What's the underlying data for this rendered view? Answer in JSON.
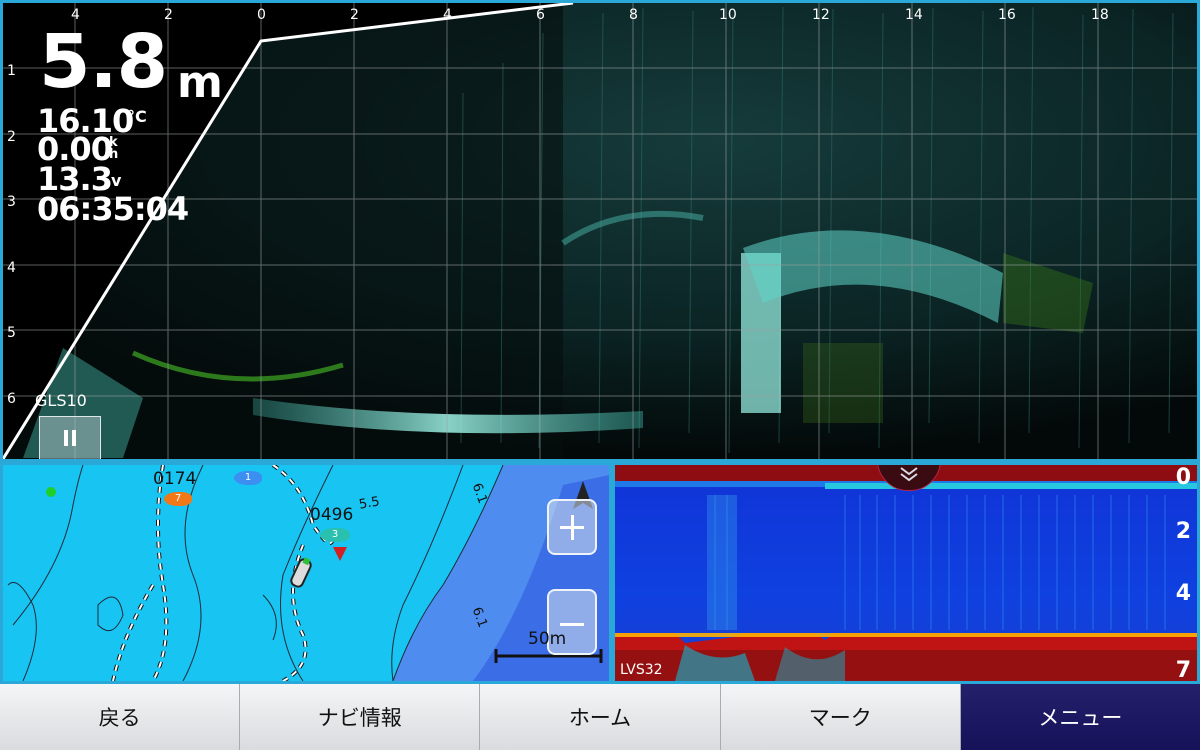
{
  "livescope": {
    "depth_value": "5.8",
    "depth_unit": "m",
    "temperature_value": "16.10",
    "temperature_unit": "°C",
    "speed_value": "0.00",
    "speed_unit": "k h",
    "voltage_value": "13.3",
    "voltage_unit": "v",
    "time_value": "06:35:04",
    "transducer_label": "GLS10",
    "range_ticks_left": [
      "4",
      "2"
    ],
    "range_ticks_right": [
      "0",
      "2",
      "4",
      "6",
      "8",
      "10",
      "12",
      "14",
      "16",
      "18"
    ],
    "depth_ticks": [
      "1",
      "2",
      "3",
      "4",
      "5",
      "6"
    ]
  },
  "chart": {
    "waypoint_a": "0174",
    "waypoint_b": "0496",
    "fish_a_count": "7",
    "fish_b_count": "1",
    "fish_c_count": "3",
    "contour_labels": [
      "6.1",
      "6.1",
      "5.5"
    ],
    "scale_label": "50m",
    "zoom_in_icon": "plus-icon",
    "zoom_out_icon": "minus-icon",
    "north_icon": "north-arrow-icon"
  },
  "sonar": {
    "depth_ticks": [
      "0",
      "2",
      "4",
      "7"
    ],
    "source_label": "LVS32",
    "collapse_icon": "chevron-double-down-icon"
  },
  "bottom_bar": {
    "back": "戻る",
    "nav_info": "ナビ情報",
    "home": "ホーム",
    "mark": "マーク",
    "menu": "メニュー"
  },
  "colors": {
    "frame": "#2aa9d8",
    "water": "#18c4f2",
    "echo": "#6ee8dc",
    "menu_active": "#1a1762"
  }
}
